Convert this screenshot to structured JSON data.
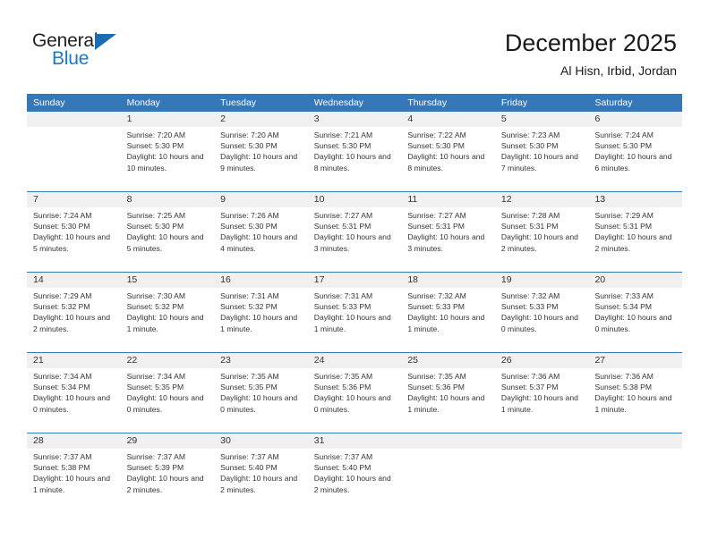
{
  "brand": {
    "name_top": "General",
    "name_bottom": "Blue",
    "accent_color": "#1b79c4",
    "triangle_color": "#1b6cb0"
  },
  "header": {
    "title": "December 2025",
    "subtitle": "Al Hisn, Irbid, Jordan"
  },
  "calendar": {
    "header_bg": "#3577b7",
    "day_number_bg": "#f0f0f0",
    "weekday_labels": [
      "Sunday",
      "Monday",
      "Tuesday",
      "Wednesday",
      "Thursday",
      "Friday",
      "Saturday"
    ],
    "weeks": [
      [
        {
          "day": "",
          "sunrise": "",
          "sunset": "",
          "daylight": "",
          "empty": true
        },
        {
          "day": "1",
          "sunrise": "Sunrise: 7:20 AM",
          "sunset": "Sunset: 5:30 PM",
          "daylight": "Daylight: 10 hours and 10 minutes."
        },
        {
          "day": "2",
          "sunrise": "Sunrise: 7:20 AM",
          "sunset": "Sunset: 5:30 PM",
          "daylight": "Daylight: 10 hours and 9 minutes."
        },
        {
          "day": "3",
          "sunrise": "Sunrise: 7:21 AM",
          "sunset": "Sunset: 5:30 PM",
          "daylight": "Daylight: 10 hours and 8 minutes."
        },
        {
          "day": "4",
          "sunrise": "Sunrise: 7:22 AM",
          "sunset": "Sunset: 5:30 PM",
          "daylight": "Daylight: 10 hours and 8 minutes."
        },
        {
          "day": "5",
          "sunrise": "Sunrise: 7:23 AM",
          "sunset": "Sunset: 5:30 PM",
          "daylight": "Daylight: 10 hours and 7 minutes."
        },
        {
          "day": "6",
          "sunrise": "Sunrise: 7:24 AM",
          "sunset": "Sunset: 5:30 PM",
          "daylight": "Daylight: 10 hours and 6 minutes."
        }
      ],
      [
        {
          "day": "7",
          "sunrise": "Sunrise: 7:24 AM",
          "sunset": "Sunset: 5:30 PM",
          "daylight": "Daylight: 10 hours and 5 minutes."
        },
        {
          "day": "8",
          "sunrise": "Sunrise: 7:25 AM",
          "sunset": "Sunset: 5:30 PM",
          "daylight": "Daylight: 10 hours and 5 minutes."
        },
        {
          "day": "9",
          "sunrise": "Sunrise: 7:26 AM",
          "sunset": "Sunset: 5:30 PM",
          "daylight": "Daylight: 10 hours and 4 minutes."
        },
        {
          "day": "10",
          "sunrise": "Sunrise: 7:27 AM",
          "sunset": "Sunset: 5:31 PM",
          "daylight": "Daylight: 10 hours and 3 minutes."
        },
        {
          "day": "11",
          "sunrise": "Sunrise: 7:27 AM",
          "sunset": "Sunset: 5:31 PM",
          "daylight": "Daylight: 10 hours and 3 minutes."
        },
        {
          "day": "12",
          "sunrise": "Sunrise: 7:28 AM",
          "sunset": "Sunset: 5:31 PM",
          "daylight": "Daylight: 10 hours and 2 minutes."
        },
        {
          "day": "13",
          "sunrise": "Sunrise: 7:29 AM",
          "sunset": "Sunset: 5:31 PM",
          "daylight": "Daylight: 10 hours and 2 minutes."
        }
      ],
      [
        {
          "day": "14",
          "sunrise": "Sunrise: 7:29 AM",
          "sunset": "Sunset: 5:32 PM",
          "daylight": "Daylight: 10 hours and 2 minutes."
        },
        {
          "day": "15",
          "sunrise": "Sunrise: 7:30 AM",
          "sunset": "Sunset: 5:32 PM",
          "daylight": "Daylight: 10 hours and 1 minute."
        },
        {
          "day": "16",
          "sunrise": "Sunrise: 7:31 AM",
          "sunset": "Sunset: 5:32 PM",
          "daylight": "Daylight: 10 hours and 1 minute."
        },
        {
          "day": "17",
          "sunrise": "Sunrise: 7:31 AM",
          "sunset": "Sunset: 5:33 PM",
          "daylight": "Daylight: 10 hours and 1 minute."
        },
        {
          "day": "18",
          "sunrise": "Sunrise: 7:32 AM",
          "sunset": "Sunset: 5:33 PM",
          "daylight": "Daylight: 10 hours and 1 minute."
        },
        {
          "day": "19",
          "sunrise": "Sunrise: 7:32 AM",
          "sunset": "Sunset: 5:33 PM",
          "daylight": "Daylight: 10 hours and 0 minutes."
        },
        {
          "day": "20",
          "sunrise": "Sunrise: 7:33 AM",
          "sunset": "Sunset: 5:34 PM",
          "daylight": "Daylight: 10 hours and 0 minutes."
        }
      ],
      [
        {
          "day": "21",
          "sunrise": "Sunrise: 7:34 AM",
          "sunset": "Sunset: 5:34 PM",
          "daylight": "Daylight: 10 hours and 0 minutes."
        },
        {
          "day": "22",
          "sunrise": "Sunrise: 7:34 AM",
          "sunset": "Sunset: 5:35 PM",
          "daylight": "Daylight: 10 hours and 0 minutes."
        },
        {
          "day": "23",
          "sunrise": "Sunrise: 7:35 AM",
          "sunset": "Sunset: 5:35 PM",
          "daylight": "Daylight: 10 hours and 0 minutes."
        },
        {
          "day": "24",
          "sunrise": "Sunrise: 7:35 AM",
          "sunset": "Sunset: 5:36 PM",
          "daylight": "Daylight: 10 hours and 0 minutes."
        },
        {
          "day": "25",
          "sunrise": "Sunrise: 7:35 AM",
          "sunset": "Sunset: 5:36 PM",
          "daylight": "Daylight: 10 hours and 1 minute."
        },
        {
          "day": "26",
          "sunrise": "Sunrise: 7:36 AM",
          "sunset": "Sunset: 5:37 PM",
          "daylight": "Daylight: 10 hours and 1 minute."
        },
        {
          "day": "27",
          "sunrise": "Sunrise: 7:36 AM",
          "sunset": "Sunset: 5:38 PM",
          "daylight": "Daylight: 10 hours and 1 minute."
        }
      ],
      [
        {
          "day": "28",
          "sunrise": "Sunrise: 7:37 AM",
          "sunset": "Sunset: 5:38 PM",
          "daylight": "Daylight: 10 hours and 1 minute."
        },
        {
          "day": "29",
          "sunrise": "Sunrise: 7:37 AM",
          "sunset": "Sunset: 5:39 PM",
          "daylight": "Daylight: 10 hours and 2 minutes."
        },
        {
          "day": "30",
          "sunrise": "Sunrise: 7:37 AM",
          "sunset": "Sunset: 5:40 PM",
          "daylight": "Daylight: 10 hours and 2 minutes."
        },
        {
          "day": "31",
          "sunrise": "Sunrise: 7:37 AM",
          "sunset": "Sunset: 5:40 PM",
          "daylight": "Daylight: 10 hours and 2 minutes."
        },
        {
          "day": "",
          "sunrise": "",
          "sunset": "",
          "daylight": "",
          "empty": true
        },
        {
          "day": "",
          "sunrise": "",
          "sunset": "",
          "daylight": "",
          "empty": true
        },
        {
          "day": "",
          "sunrise": "",
          "sunset": "",
          "daylight": "",
          "empty": true
        }
      ]
    ]
  }
}
